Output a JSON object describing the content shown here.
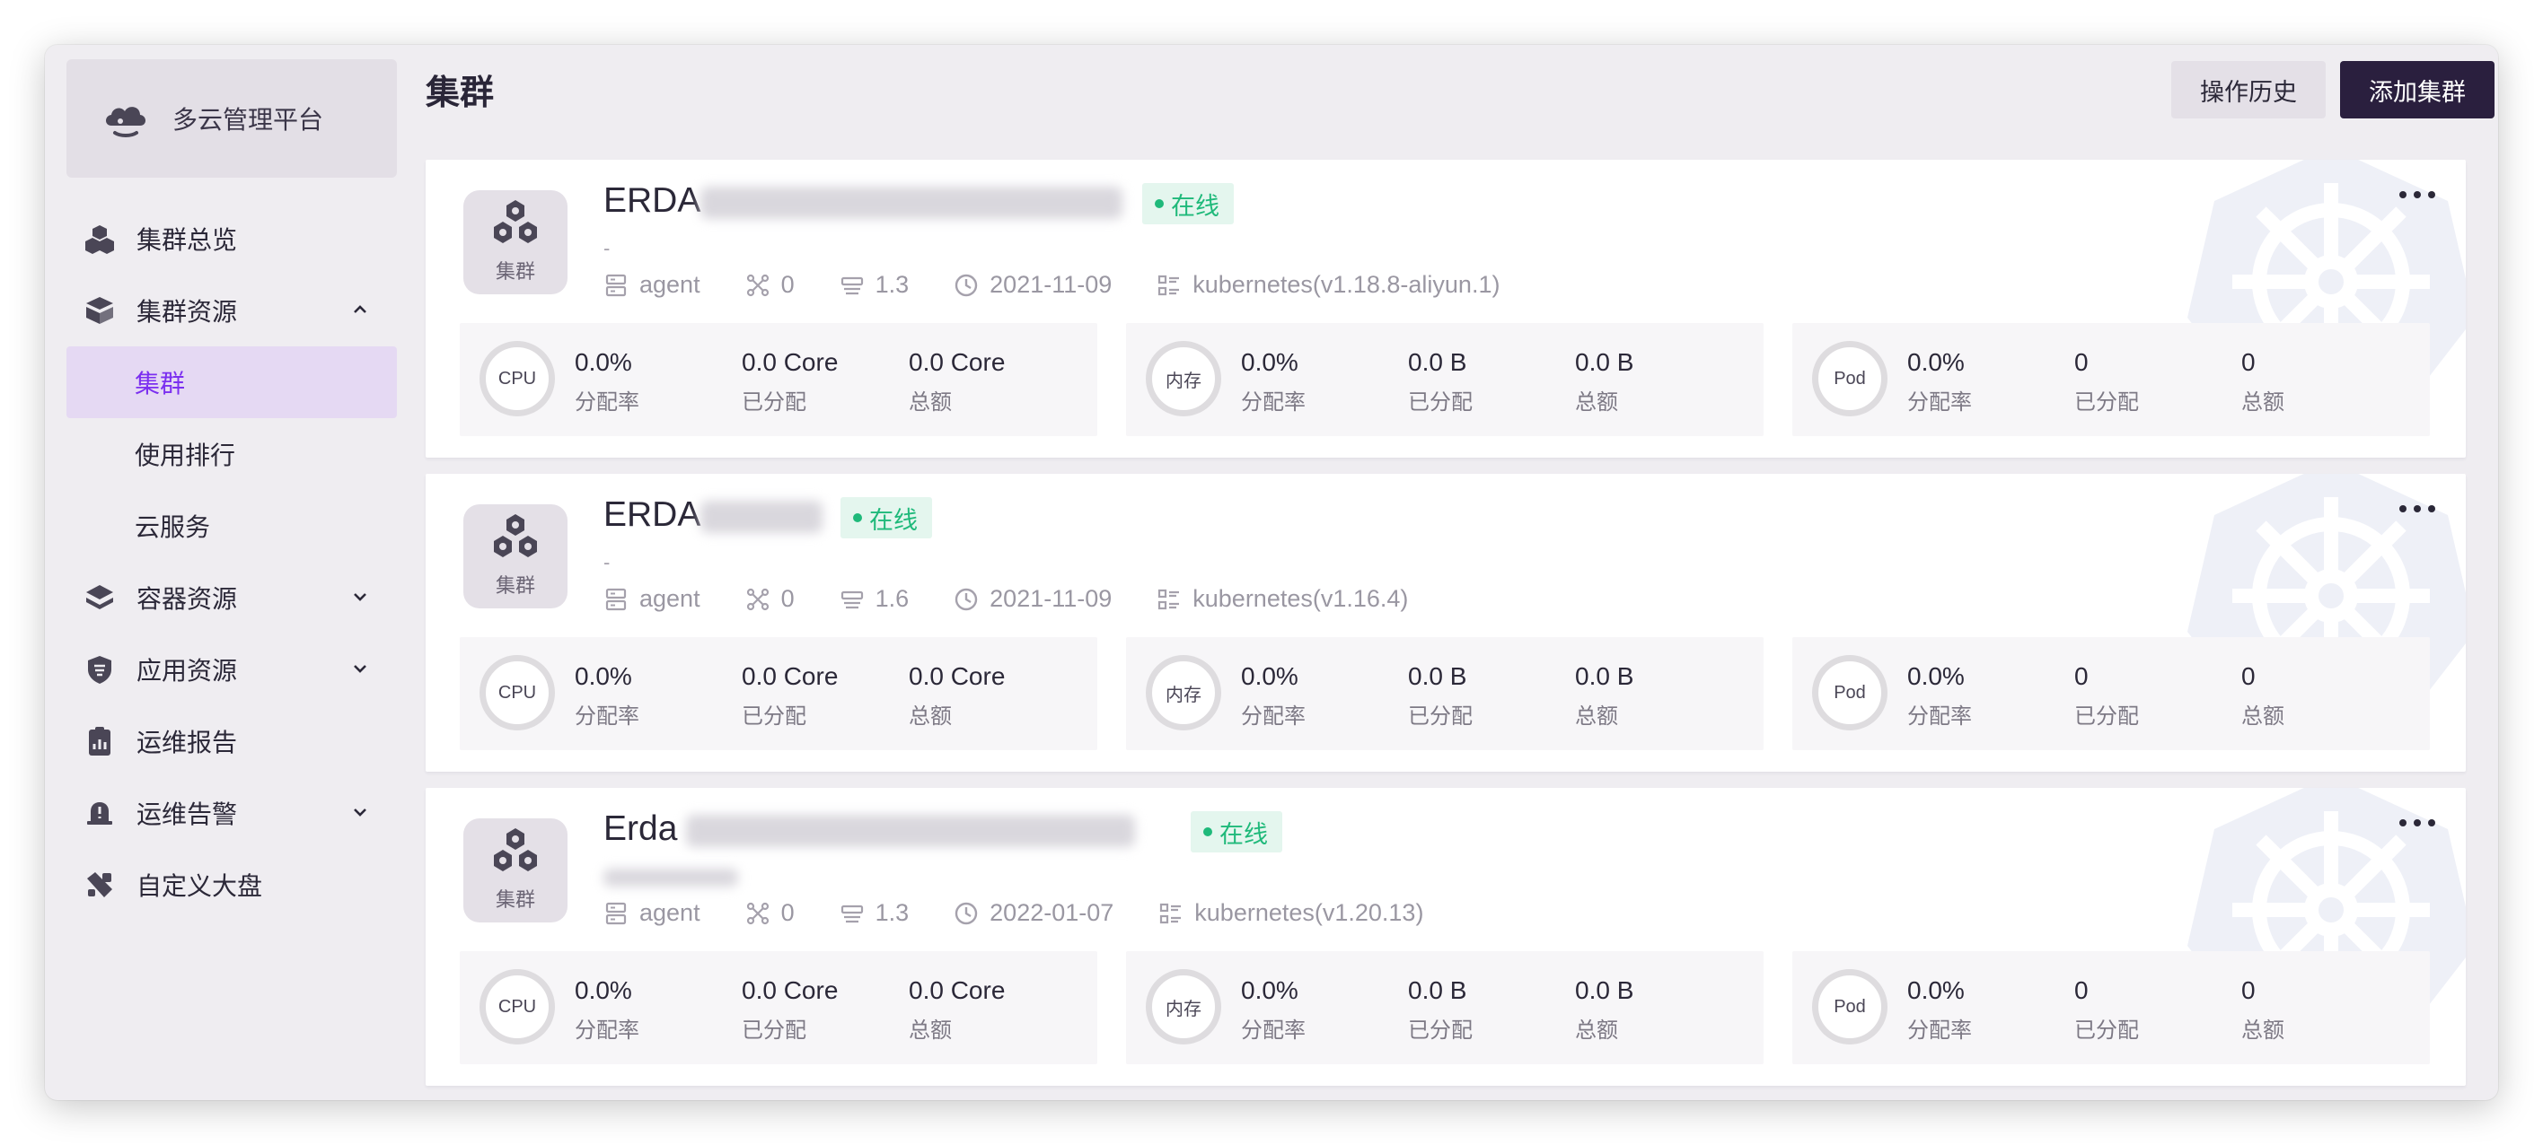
{
  "sidebar": {
    "brand": "多云管理平台",
    "items": [
      {
        "label": "集群总览"
      },
      {
        "label": "集群资源",
        "expanded": true,
        "children": [
          {
            "label": "集群",
            "active": true
          },
          {
            "label": "使用排行"
          },
          {
            "label": "云服务"
          }
        ]
      },
      {
        "label": "容器资源"
      },
      {
        "label": "应用资源"
      },
      {
        "label": "运维报告"
      },
      {
        "label": "运维告警"
      },
      {
        "label": "自定义大盘"
      }
    ]
  },
  "header": {
    "title": "集群",
    "history_button": "操作历史",
    "add_button": "添加集群"
  },
  "colors": {
    "accent": "#7b2ff0",
    "primary_button": "#2a1f3e",
    "online_status": "#1fb97a"
  },
  "clusters": [
    {
      "name": "ERDA",
      "avatar_label": "集群",
      "status": "在线",
      "description": "-",
      "type": "agent",
      "node_count": "0",
      "version": "1.3",
      "created": "2021-11-09",
      "kubernetes": "kubernetes(v1.18.8-aliyun.1)",
      "cpu": {
        "badge": "CPU",
        "rate": "0.0%",
        "rate_label": "分配率",
        "allocated": "0.0 Core",
        "allocated_label": "已分配",
        "total": "0.0 Core",
        "total_label": "总额"
      },
      "mem": {
        "badge": "内存",
        "rate": "0.0%",
        "rate_label": "分配率",
        "allocated": "0.0 B",
        "allocated_label": "已分配",
        "total": "0.0 B",
        "total_label": "总额"
      },
      "pod": {
        "badge": "Pod",
        "rate": "0.0%",
        "rate_label": "分配率",
        "allocated": "0",
        "allocated_label": "已分配",
        "total": "0",
        "total_label": "总额"
      }
    },
    {
      "name": "ERDA",
      "avatar_label": "集群",
      "status": "在线",
      "description": "-",
      "type": "agent",
      "node_count": "0",
      "version": "1.6",
      "created": "2021-11-09",
      "kubernetes": "kubernetes(v1.16.4)",
      "cpu": {
        "badge": "CPU",
        "rate": "0.0%",
        "rate_label": "分配率",
        "allocated": "0.0 Core",
        "allocated_label": "已分配",
        "total": "0.0 Core",
        "total_label": "总额"
      },
      "mem": {
        "badge": "内存",
        "rate": "0.0%",
        "rate_label": "分配率",
        "allocated": "0.0 B",
        "allocated_label": "已分配",
        "total": "0.0 B",
        "total_label": "总额"
      },
      "pod": {
        "badge": "Pod",
        "rate": "0.0%",
        "rate_label": "分配率",
        "allocated": "0",
        "allocated_label": "已分配",
        "total": "0",
        "total_label": "总额"
      }
    },
    {
      "name": "Erda",
      "avatar_label": "集群",
      "status": "在线",
      "description": "",
      "type": "agent",
      "node_count": "0",
      "version": "1.3",
      "created": "2022-01-07",
      "kubernetes": "kubernetes(v1.20.13)",
      "cpu": {
        "badge": "CPU",
        "rate": "0.0%",
        "rate_label": "分配率",
        "allocated": "0.0 Core",
        "allocated_label": "已分配",
        "total": "0.0 Core",
        "total_label": "总额"
      },
      "mem": {
        "badge": "内存",
        "rate": "0.0%",
        "rate_label": "分配率",
        "allocated": "0.0 B",
        "allocated_label": "已分配",
        "total": "0.0 B",
        "total_label": "总额"
      },
      "pod": {
        "badge": "Pod",
        "rate": "0.0%",
        "rate_label": "分配率",
        "allocated": "0",
        "allocated_label": "已分配",
        "total": "0",
        "total_label": "总额"
      }
    }
  ]
}
